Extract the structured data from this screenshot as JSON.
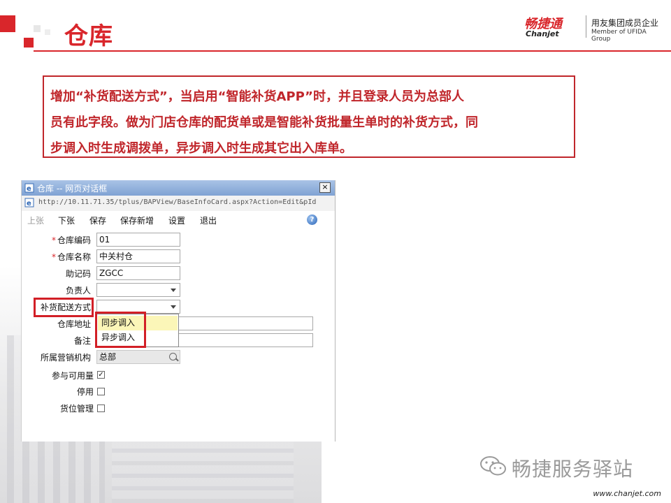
{
  "slide": {
    "title": "仓库",
    "note_lines": [
      "增加“补货配送方式”，当启用“智能补货APP”时，并且登录人员为总部人",
      "员有此字段。做为门店仓库的配货单或是智能补货批量生单时的补货方式，同",
      "步调入时生成调拨单，异步调入时生成其它出入库单。"
    ]
  },
  "logo": {
    "cn": "畅捷通",
    "en": "Chanjet",
    "tagline_cn": "用友集团成员企业",
    "tagline_en": "Member of UFIDA Group"
  },
  "dialog": {
    "title": "仓库 -- 网页对话框",
    "close_glyph": "×",
    "url": "http://10.11.71.35/tplus/BAPView/BaseInfoCard.aspx?Action=Edit&pId",
    "toolbar": {
      "prev": "上张",
      "next": "下张",
      "save": "保存",
      "save_new": "保存新增",
      "settings": "设置",
      "exit": "退出",
      "help_glyph": "?"
    },
    "fields": {
      "code_label": "仓库编码",
      "code_value": "01",
      "name_label": "仓库名称",
      "name_value": "中关村仓",
      "mnemonic_label": "助记码",
      "mnemonic_value": "ZGCC",
      "manager_label": "负责人",
      "manager_value": "",
      "delivery_label": "补货配送方式",
      "delivery_value": "",
      "address_label": "仓库地址",
      "address_value": "",
      "remark_label": "备注",
      "remark_value": "",
      "org_label": "所属营销机构",
      "org_value": "总部",
      "available_label": "参与可用量",
      "available_checked": "✓",
      "disabled_label": "停用",
      "location_label": "货位管理"
    },
    "required_mark": "*",
    "dropdown_options": [
      "同步调入",
      "异步调入"
    ]
  },
  "footer": {
    "brand": "畅捷服务驿站",
    "website": "www.chanjet.com"
  }
}
